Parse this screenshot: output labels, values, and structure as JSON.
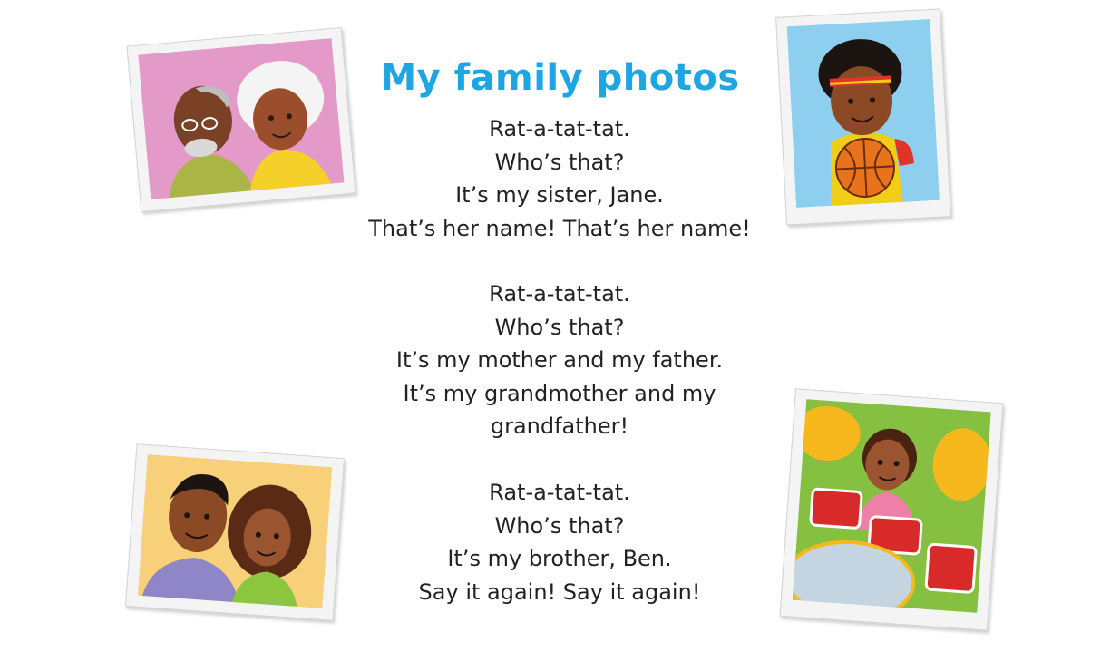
{
  "title": "My family photos",
  "stanzas": [
    [
      "Rat-a-tat-tat.",
      "Who’s that?",
      "It’s my sister, Jane.",
      "That’s her name! That’s her name!"
    ],
    [
      "Rat-a-tat-tat.",
      "Who’s that?",
      "It’s my mother and my father.",
      "It’s my grandmother and my",
      "grandfather!"
    ],
    [
      "Rat-a-tat-tat.",
      "Who’s that?",
      "It’s my brother, Ben.",
      "Say it again! Say it again!"
    ]
  ],
  "photos": [
    {
      "subject": "grandparents",
      "bg": "#e49ac8"
    },
    {
      "subject": "boy-with-basketball",
      "bg": "#8ecff0"
    },
    {
      "subject": "mother-and-father",
      "bg": "#f8d079"
    },
    {
      "subject": "girl-playing-drums",
      "bg": "#86c041"
    }
  ]
}
